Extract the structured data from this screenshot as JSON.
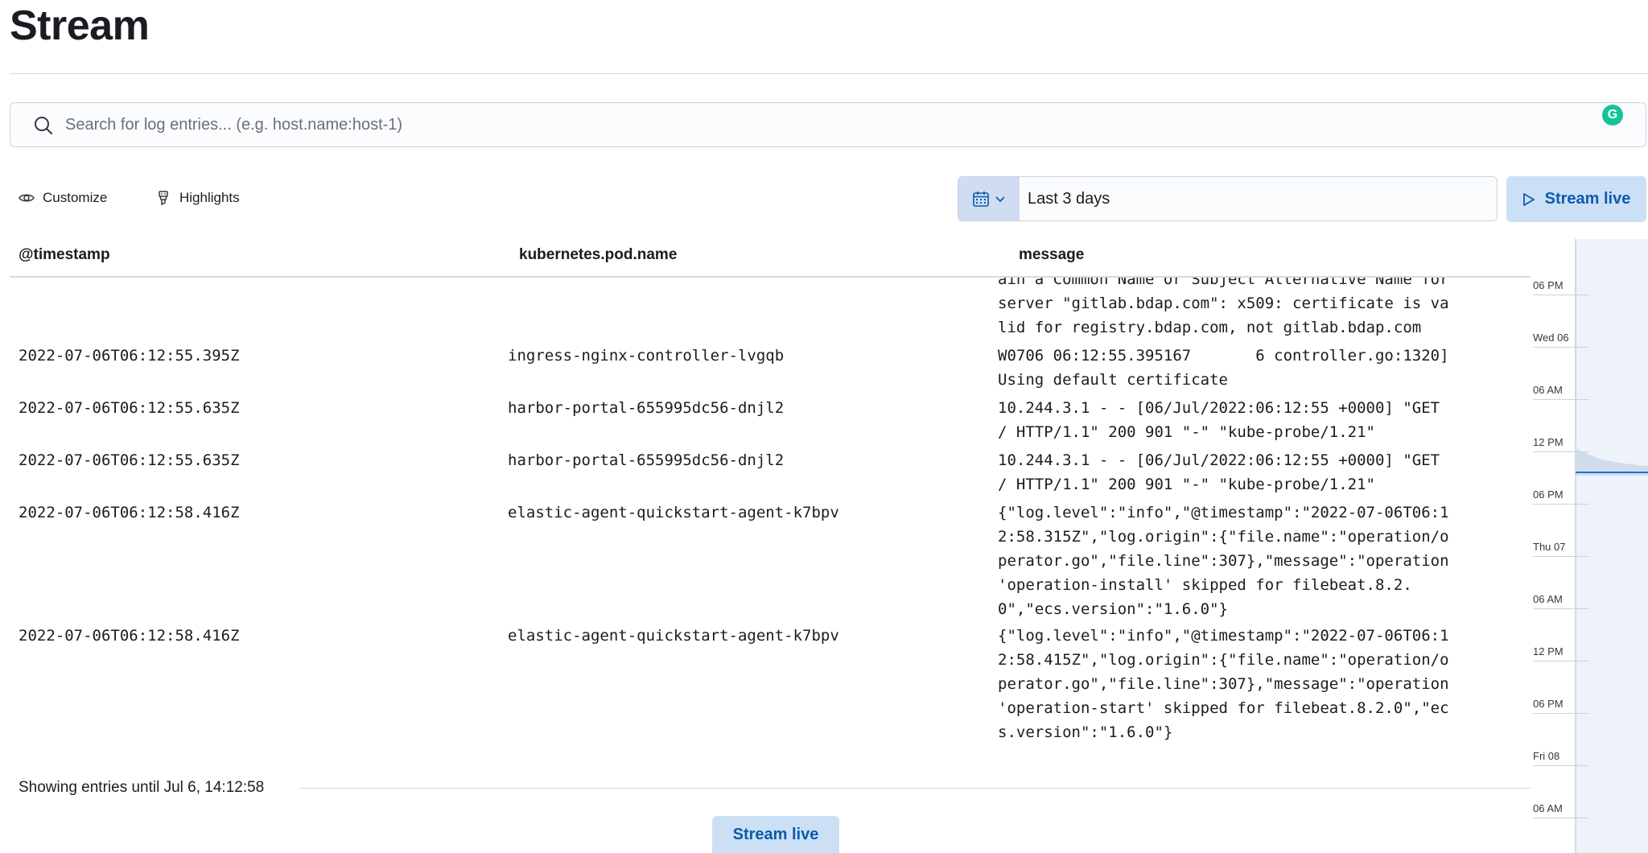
{
  "page": {
    "title": "Stream"
  },
  "search": {
    "placeholder": "Search for log entries... (e.g. host.name:host-1)",
    "value": "",
    "badge": "G"
  },
  "toolbar": {
    "customize": "Customize",
    "highlights": "Highlights"
  },
  "date_picker": {
    "value": "Last 3 days"
  },
  "stream_live_label": "Stream live",
  "columns": [
    "@timestamp",
    "kubernetes.pod.name",
    "message"
  ],
  "log_rows": [
    {
      "timestamp": "",
      "pod": "",
      "message": "ain a Common Name or Subject Alternative Name for\nserver \"gitlab.bdap.com\": x509: certificate is va\nlid for registry.bdap.com, not gitlab.bdap.com"
    },
    {
      "timestamp": "2022-07-06T06:12:55.395Z",
      "pod": "ingress-nginx-controller-lvgqb",
      "message": "W0706 06:12:55.395167       6 controller.go:1320]\nUsing default certificate"
    },
    {
      "timestamp": "2022-07-06T06:12:55.635Z",
      "pod": "harbor-portal-655995dc56-dnjl2",
      "message": "10.244.3.1 - - [06/Jul/2022:06:12:55 +0000] \"GET\n/ HTTP/1.1\" 200 901 \"-\" \"kube-probe/1.21\""
    },
    {
      "timestamp": "2022-07-06T06:12:55.635Z",
      "pod": "harbor-portal-655995dc56-dnjl2",
      "message": "10.244.3.1 - - [06/Jul/2022:06:12:55 +0000] \"GET\n/ HTTP/1.1\" 200 901 \"-\" \"kube-probe/1.21\""
    },
    {
      "timestamp": "2022-07-06T06:12:58.416Z",
      "pod": "elastic-agent-quickstart-agent-k7bpv",
      "message": "{\"log.level\":\"info\",\"@timestamp\":\"2022-07-06T06:1\n2:58.315Z\",\"log.origin\":{\"file.name\":\"operation/o\nperator.go\",\"file.line\":307},\"message\":\"operation\n'operation-install' skipped for filebeat.8.2.\n0\",\"ecs.version\":\"1.6.0\"}"
    },
    {
      "timestamp": "2022-07-06T06:12:58.416Z",
      "pod": "elastic-agent-quickstart-agent-k7bpv",
      "message": "{\"log.level\":\"info\",\"@timestamp\":\"2022-07-06T06:1\n2:58.415Z\",\"log.origin\":{\"file.name\":\"operation/o\nperator.go\",\"file.line\":307},\"message\":\"operation\n'operation-start' skipped for filebeat.8.2.0\",\"ec\ns.version\":\"1.6.0\"}"
    }
  ],
  "footer": {
    "text": "Showing entries until Jul 6, 14:12:58"
  },
  "minimap": {
    "labels": [
      "06 PM",
      "Wed 06",
      "06 AM",
      "12 PM",
      "06 PM",
      "Thu 07",
      "06 AM",
      "12 PM",
      "06 PM",
      "Fri 08",
      "06 AM"
    ]
  },
  "colors": {
    "accent": "#0b5cad",
    "button_bg": "#cce0f5",
    "border": "#d3dae6",
    "minimap_line": "#1f6ed4"
  }
}
